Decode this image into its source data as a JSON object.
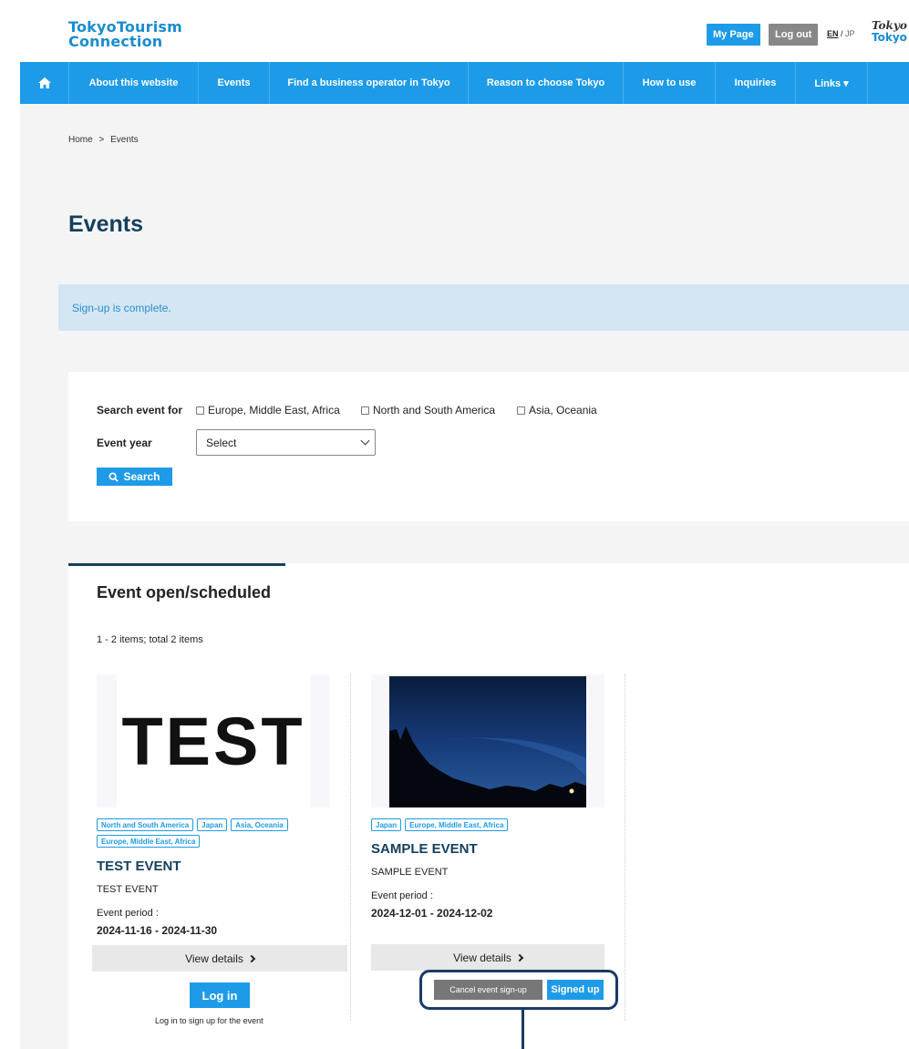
{
  "header": {
    "logo_line1": "TokyoTourism",
    "logo_line2": "Connection",
    "my_page": "My Page",
    "log_out": "Log out",
    "lang_en": "EN",
    "lang_sep": " / ",
    "lang_jp": "JP",
    "tokyo_logo_script": "Tokyo",
    "tokyo_logo_text": "Tokyo"
  },
  "nav": {
    "home_icon": "home-icon",
    "items": [
      "About this website",
      "Events",
      "Find a business operator in Tokyo",
      "Reason to choose Tokyo",
      "How to use",
      "Inquiries",
      "Links ▾"
    ]
  },
  "breadcrumb": {
    "home": "Home",
    "sep": ">",
    "current": "Events"
  },
  "page_title": "Events",
  "alert": "Sign-up is complete.",
  "search": {
    "label_for": "Search event for",
    "options": [
      "Europe, Middle East, Africa",
      "North and South America",
      "Asia, Oceania"
    ],
    "year_label": "Event year",
    "year_value": "Select",
    "search_button": "Search"
  },
  "events": {
    "title": "Event open/scheduled",
    "count": "1 - 2 items; total 2 items",
    "items": [
      {
        "thumb_text": "TEST",
        "tags": [
          "North and South America",
          "Japan",
          "Asia, Oceania",
          "Europe, Middle East, Africa"
        ],
        "title": "TEST EVENT",
        "subtitle": "TEST EVENT",
        "period_label": "Event period :",
        "period": "2024-11-16 - 2024-11-30",
        "view_details": "View details",
        "login_button": "Log in",
        "login_note": "Log in to sign up for the event"
      },
      {
        "thumb_alt": "night-sky-photo",
        "tags": [
          "Japan",
          "Europe, Middle East, Africa"
        ],
        "title": "SAMPLE EVENT",
        "subtitle": "SAMPLE EVENT",
        "period_label": "Event period :",
        "period": "2024-12-01 - 2024-12-02",
        "view_details": "View details",
        "cancel_button": "Cancel event sign-up",
        "signed_button": "Signed up"
      }
    ]
  },
  "colors": {
    "primary": "#1e9be8",
    "title": "#14405e",
    "alert_bg": "#d4e6f2"
  }
}
